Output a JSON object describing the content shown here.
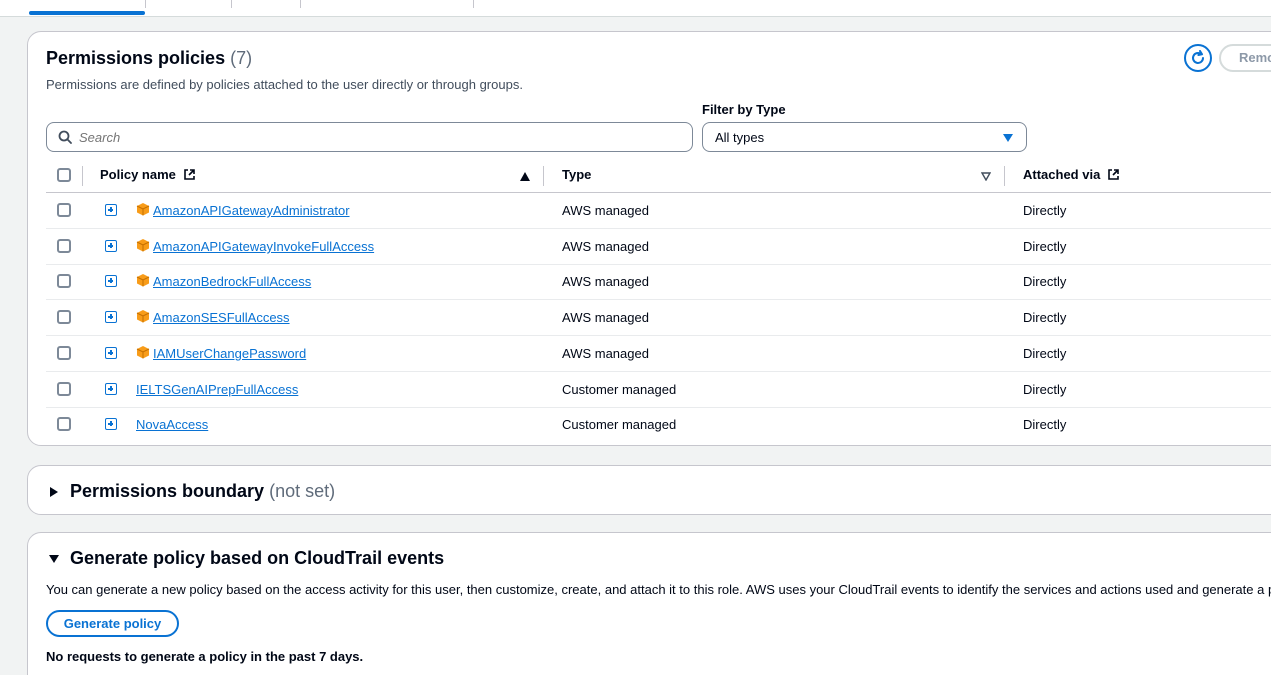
{
  "policies_panel": {
    "title": "Permissions policies",
    "count": "(7)",
    "description": "Permissions are defined by policies attached to the user directly or through groups.",
    "remove_label": "Remove",
    "search_placeholder": "Search",
    "filter_label": "Filter by Type",
    "filter_value": "All types",
    "columns": {
      "policy_name": "Policy name",
      "type": "Type",
      "attached_via": "Attached via"
    },
    "rows": [
      {
        "name": "AmazonAPIGatewayAdministrator",
        "type": "AWS managed",
        "attached": "Directly",
        "aws": true
      },
      {
        "name": "AmazonAPIGatewayInvokeFullAccess",
        "type": "AWS managed",
        "attached": "Directly",
        "aws": true
      },
      {
        "name": "AmazonBedrockFullAccess",
        "type": "AWS managed",
        "attached": "Directly",
        "aws": true
      },
      {
        "name": "AmazonSESFullAccess",
        "type": "AWS managed",
        "attached": "Directly",
        "aws": true
      },
      {
        "name": "IAMUserChangePassword",
        "type": "AWS managed",
        "attached": "Directly",
        "aws": true
      },
      {
        "name": "IELTSGenAIPrepFullAccess",
        "type": "Customer managed",
        "attached": "Directly",
        "aws": false
      },
      {
        "name": "NovaAccess",
        "type": "Customer managed",
        "attached": "Directly",
        "aws": false
      }
    ]
  },
  "boundary_panel": {
    "title": "Permissions boundary",
    "note": "(not set)"
  },
  "cloudtrail_panel": {
    "title": "Generate policy based on CloudTrail events",
    "description": "You can generate a new policy based on the access activity for this user, then customize, create, and attach it to this role. AWS uses your CloudTrail events to identify the services and actions used and generate a policy.",
    "button_label": "Generate policy",
    "status": "No requests to generate a policy in the past 7 days."
  },
  "colors": {
    "accent": "#0972d3",
    "aws_icon": "#f89c19"
  }
}
